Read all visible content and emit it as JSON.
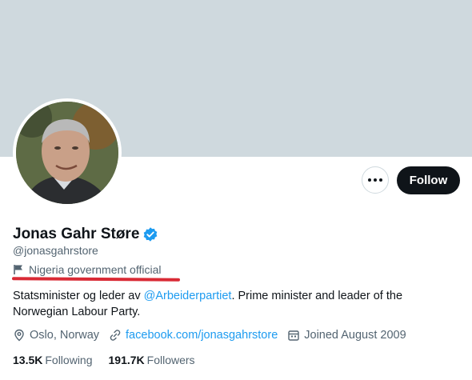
{
  "profile": {
    "display_name": "Jonas Gahr Støre",
    "handle": "@jonasgahrstore",
    "affiliation_label": "Nigeria government official",
    "bio": {
      "text_before": "Statsminister og leder av ",
      "mention": "@Arbeiderpartiet",
      "text_after": ". Prime minister and leader of the Norwegian Labour Party."
    },
    "location": "Oslo, Norway",
    "website": "facebook.com/jonasgahrstore",
    "joined": "Joined August 2009",
    "following_count": "13.5K",
    "following_label": "Following",
    "followers_count": "191.7K",
    "followers_label": "Followers"
  },
  "actions": {
    "follow_label": "Follow",
    "more_icon": "more-icon"
  },
  "colors": {
    "banner": "#cfd9de",
    "accent": "#1d9bf0",
    "follow_bg": "#0f1419",
    "annotation_underline": "#d92a35"
  }
}
